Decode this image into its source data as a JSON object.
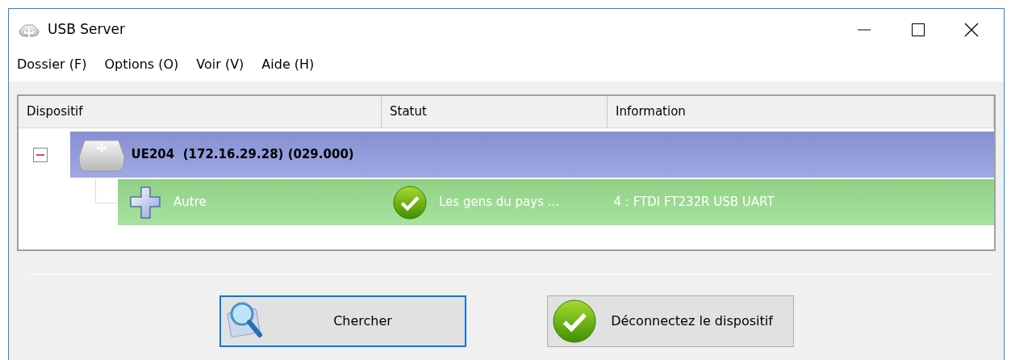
{
  "window": {
    "title": "USB Server"
  },
  "menu": [
    "Dossier (F)",
    "Options (O)",
    "Voir (V)",
    "Aide (H)"
  ],
  "tree": {
    "columns": [
      "Dispositif",
      "Statut",
      "Information"
    ],
    "nodes": [
      {
        "kind": "hub",
        "name": "UE204  (172.16.29.28) (029.000)",
        "expanded": true,
        "children": [
          {
            "kind": "device",
            "name": "Autre",
            "status": "Les gens du pays ...",
            "information": "4 : FTDI FT232R USB UART"
          }
        ]
      }
    ]
  },
  "buttons": [
    {
      "kind": "search",
      "label": "Chercher",
      "focused": true
    },
    {
      "kind": "disconnect",
      "label": "Déconnectez le dispositif",
      "focused": false
    }
  ]
}
